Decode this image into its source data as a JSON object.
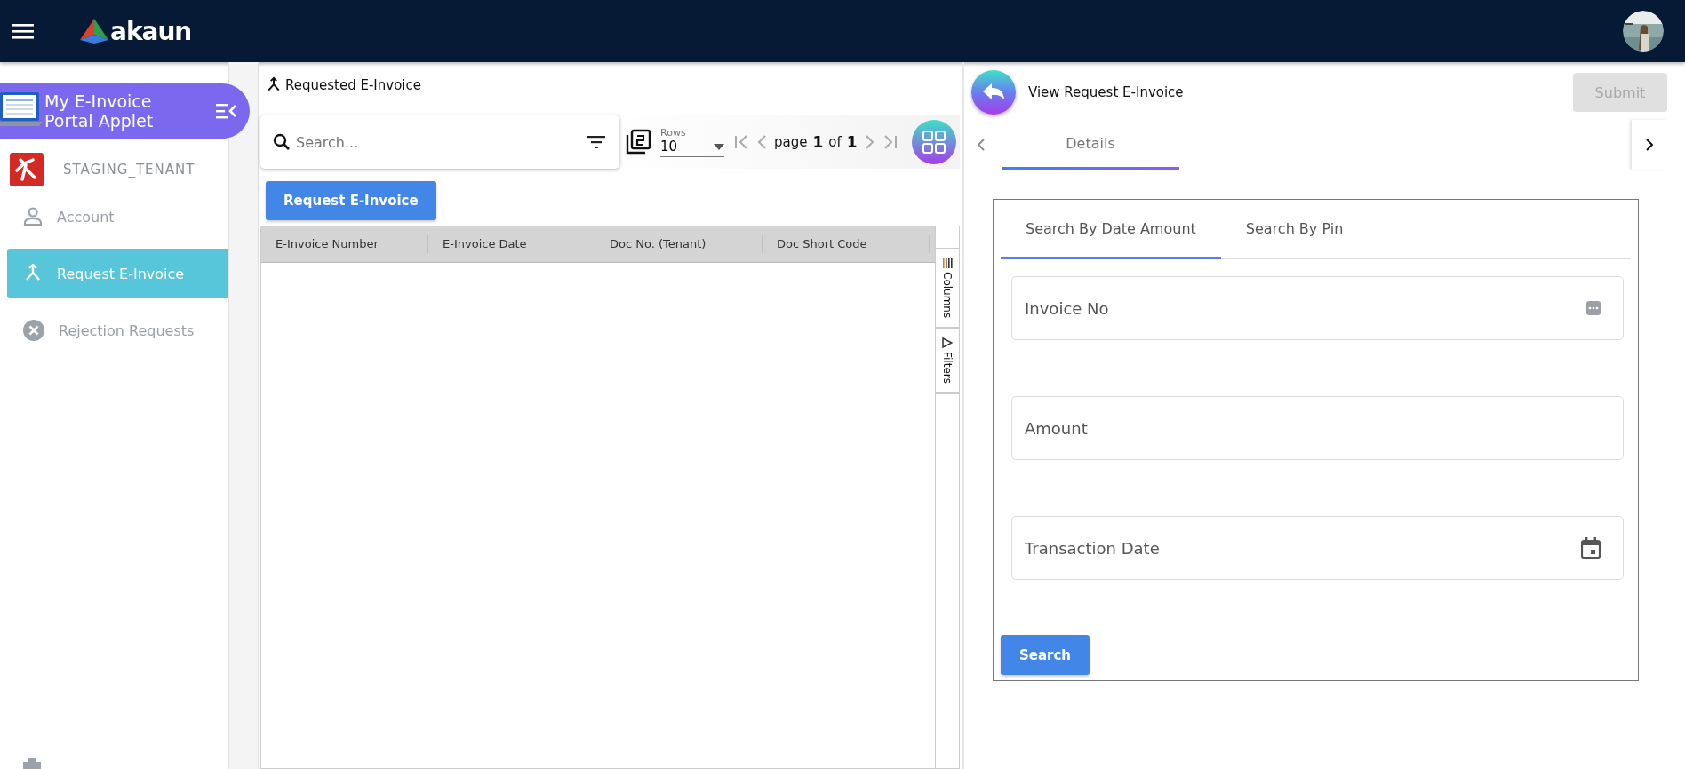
{
  "header": {
    "logo_text": "akaun"
  },
  "sidebar": {
    "applet_title": "My E-Invoice Portal Applet",
    "tenant": "STAGING_TENANT",
    "items": [
      {
        "label": "Account",
        "kind": "account",
        "selected": false
      },
      {
        "label": "Request E-Invoice",
        "kind": "request",
        "selected": true
      },
      {
        "label": "Rejection Requests",
        "kind": "rejection",
        "selected": false
      }
    ]
  },
  "list_panel": {
    "title": "Requested E-Invoice",
    "search": {
      "placeholder": "Search..."
    },
    "rows_label": "Rows",
    "rows_value": "10",
    "page_word": "page",
    "page": "1",
    "of_word": "of",
    "total_pages": "1",
    "request_button": "Request E-Invoice",
    "table": {
      "columns": [
        "E-Invoice Number",
        "E-Invoice Date",
        "Doc No. (Tenant)",
        "Doc Short Code"
      ]
    },
    "side_tabs": [
      {
        "label": "Columns",
        "kind": "columns"
      },
      {
        "label": "Filters",
        "kind": "filters"
      }
    ]
  },
  "detail_panel": {
    "title": "View Request E-Invoice",
    "submit_button": {
      "label": "Submit",
      "disabled": true
    },
    "tabs": [
      {
        "label": "Details",
        "selected": true
      }
    ],
    "search_tabs": [
      {
        "label": "Search By Date Amount",
        "selected": true
      },
      {
        "label": "Search By Pin",
        "selected": false
      }
    ],
    "fields": [
      {
        "placeholder": "Invoice No",
        "kind": "more"
      },
      {
        "placeholder": "Amount",
        "kind": "plain"
      },
      {
        "placeholder": "Transaction Date",
        "kind": "date"
      }
    ],
    "search_button": "Search"
  }
}
